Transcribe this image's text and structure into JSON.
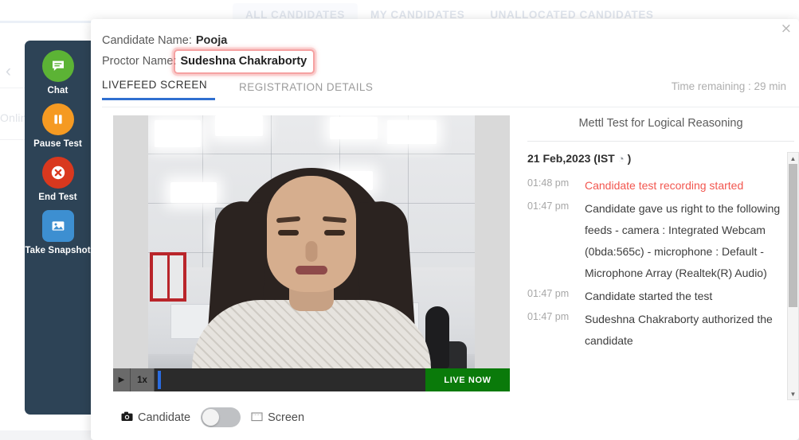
{
  "background": {
    "tabs": [
      {
        "label": "ALL CANDIDATES",
        "active": true
      },
      {
        "label": "MY CANDIDATES",
        "active": false
      },
      {
        "label": "UNALLOCATED CANDIDATES",
        "active": false
      }
    ],
    "back_chevron": "‹",
    "online_text": "Onlin"
  },
  "sidebar": {
    "items": [
      {
        "label": "Chat",
        "icon": "chat-icon",
        "color": "#5cb335",
        "shape": "circle"
      },
      {
        "label": "Pause Test",
        "icon": "pause-icon",
        "color": "#f59a22",
        "shape": "circle"
      },
      {
        "label": "End Test",
        "icon": "close-circle-icon",
        "color": "#d9381e",
        "shape": "circle"
      },
      {
        "label": "Take Snapshot",
        "icon": "image-icon",
        "color": "#3d8fd1",
        "shape": "square"
      }
    ]
  },
  "modal": {
    "close_label": "×",
    "candidate_label": "Candidate Name:",
    "candidate_name": "Pooja",
    "proctor_label": "Proctor Name:",
    "proctor_name": "Sudeshna Chakraborty",
    "tabs": [
      {
        "label": "LIVEFEED SCREEN",
        "active": true
      },
      {
        "label": "REGISTRATION DETAILS",
        "active": false
      }
    ],
    "time_remaining": "Time remaining : 29 min"
  },
  "video": {
    "play_glyph": "▶",
    "speed": "1x",
    "live_label": "LIVE NOW",
    "feed_candidate_label": "Candidate",
    "feed_screen_label": "Screen",
    "camera_glyph": "◼",
    "screen_glyph": "▭",
    "toggle_state": "off"
  },
  "log": {
    "title": "Mettl Test for Logical Reasoning",
    "date": "21 Feb,2023 (IST",
    "date_suffix": ")",
    "clock_glyph": "◔",
    "entries": [
      {
        "time": "01:48 pm",
        "text": "Candidate test recording started",
        "alert": true
      },
      {
        "time": "01:47 pm",
        "text": "Candidate gave us right to the following feeds - camera : Integrated Webcam (0bda:565c) - microphone : Default - Microphone Array (Realtek(R) Audio)",
        "alert": false
      },
      {
        "time": "01:47 pm",
        "text": "Candidate started the test",
        "alert": false
      },
      {
        "time": "01:47 pm",
        "text": "Sudeshna Chakraborty authorized the candidate",
        "alert": false
      }
    ],
    "scroll_up_glyph": "▲",
    "scroll_down_glyph": "▼"
  },
  "colors": {
    "sidebar_bg": "#2d4356",
    "tab_accent": "#2f6fd0",
    "live_green": "#0a7a0a",
    "alert_red": "#f2564f",
    "annotation_red": "#f06e6e"
  }
}
